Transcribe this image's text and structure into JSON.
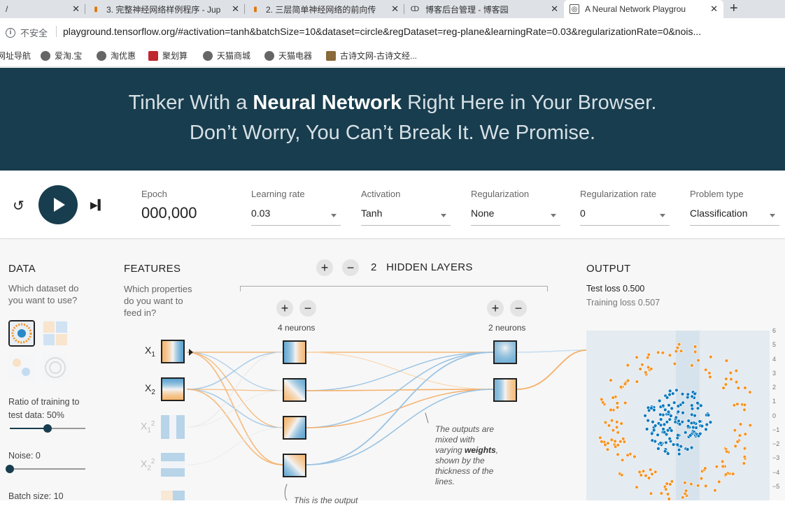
{
  "browser": {
    "tabs": [
      {
        "title": "/",
        "icon": "page-icon"
      },
      {
        "title": "3. 完整神经网络样例程序 - Jup",
        "icon": "bookmark-icon"
      },
      {
        "title": "2. 三层简单神经网络的前向传",
        "icon": "bookmark-icon"
      },
      {
        "title": "博客后台管理 - 博客园",
        "icon": "blog-icon"
      },
      {
        "title": "A Neural Network Playgrou",
        "icon": "playground-icon",
        "active": true
      }
    ],
    "new_tab": "+",
    "close": "✕",
    "security": "不安全",
    "url": "playground.tensorflow.org/#activation=tanh&batchSize=10&dataset=circle&regDataset=reg-plane&learningRate=0.03&regularizationRate=0&nois...",
    "bookmarks": [
      "网址导航",
      "爱淘.宝",
      "淘优惠",
      "聚划算",
      "天猫商城",
      "天猫电器",
      "古诗文网-古诗文经..."
    ]
  },
  "header": {
    "line1_pre": "Tinker With a ",
    "line1_bold": "Neural Network",
    "line1_post": " Right Here in Your Browser.",
    "line2": "Don’t Worry, You Can’t Break It. We Promise."
  },
  "controls": {
    "epoch_label": "Epoch",
    "epoch_value": "000,000",
    "learning_rate_label": "Learning rate",
    "learning_rate_value": "0.03",
    "activation_label": "Activation",
    "activation_value": "Tanh",
    "regularization_label": "Regularization",
    "regularization_value": "None",
    "regularization_rate_label": "Regularization rate",
    "regularization_rate_value": "0",
    "problem_type_label": "Problem type",
    "problem_type_value": "Classification"
  },
  "data_panel": {
    "title": "DATA",
    "subtitle_1": "Which dataset do",
    "subtitle_2": "you want to use?",
    "ratio_label_1": "Ratio of training to",
    "ratio_label_2": "test data:  50%",
    "ratio_value": 0.5,
    "noise_label": "Noise:  0",
    "noise_value": 0,
    "batch_label": "Batch size:  10"
  },
  "features_panel": {
    "title": "FEATURES",
    "subtitle_1": "Which properties",
    "subtitle_2": "do you want to",
    "subtitle_3": "feed in?",
    "features": [
      "X",
      "X",
      "X",
      "X"
    ],
    "subscripts": [
      "1",
      "2",
      "1",
      "2"
    ],
    "superscripts": [
      "",
      "",
      "2",
      "2"
    ]
  },
  "hidden": {
    "count": "2",
    "title": "HIDDEN LAYERS",
    "plus": "+",
    "minus": "−",
    "layer1_label": "4 neurons",
    "layer2_label": "2 neurons"
  },
  "annotations": {
    "weights_1": "The outputs are",
    "weights_2": "mixed with",
    "weights_3_pre": "varying ",
    "weights_3_bold": "weights",
    "weights_3_post": ",",
    "weights_4": "shown by the",
    "weights_5": "thickness of the",
    "weights_6": "lines.",
    "output_note": "This is the output"
  },
  "output": {
    "title": "OUTPUT",
    "test_loss": "Test loss 0.500",
    "training_loss": "Training loss 0.507",
    "axis_ticks": [
      "6",
      "5",
      "4",
      "3",
      "2",
      "1",
      "0",
      "−1",
      "−2",
      "−3",
      "−4",
      "−5"
    ]
  },
  "colors": {
    "header_bg": "#183d4e",
    "orange": "#f59322",
    "blue": "#0877bd"
  }
}
